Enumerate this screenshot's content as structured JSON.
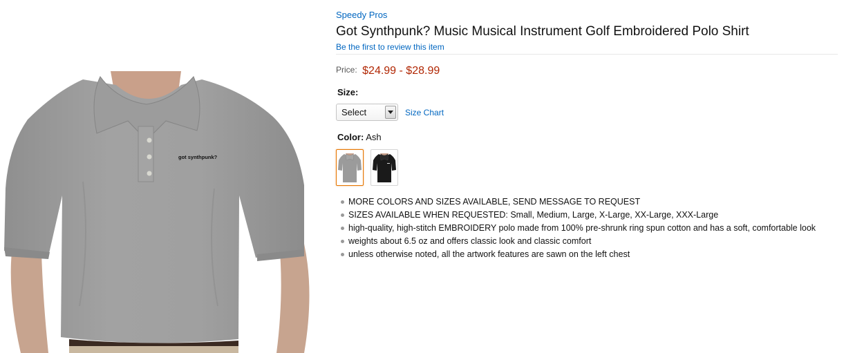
{
  "product": {
    "brand": "Speedy Pros",
    "title": "Got Synthpunk? Music Musical Instrument Golf Embroidered Polo Shirt",
    "review_link": "Be the first to review this item",
    "embroidery_text": "got synthpunk?"
  },
  "price": {
    "label": "Price:",
    "value": "$24.99 - $28.99",
    "color": "#b12704"
  },
  "size": {
    "label": "Size:",
    "selected": "Select",
    "chart_link": "Size Chart"
  },
  "color": {
    "label": "Color:",
    "selected": "Ash",
    "swatches": [
      {
        "name": "Ash",
        "hex": "#9b9b9b",
        "selected": true
      },
      {
        "name": "Black",
        "hex": "#1a1a1a",
        "selected": false
      }
    ]
  },
  "features": [
    "MORE COLORS AND SIZES AVAILABLE, SEND MESSAGE TO REQUEST",
    "SIZES AVAILABLE WHEN REQUESTED: Small, Medium, Large, X-Large, XX-Large, XXX-Large",
    "high-quality, high-stitch EMBROIDERY polo made from 100% pre-shrunk ring spun cotton and has a soft, comfortable look",
    "weights about 6.5 oz and offers classic look and classic comfort",
    "unless otherwise noted, all the artwork features are sawn on the left chest"
  ],
  "theme": {
    "link_color": "#0066c0",
    "selected_border": "#e77600",
    "shirt_color": "#9b9b9b"
  }
}
